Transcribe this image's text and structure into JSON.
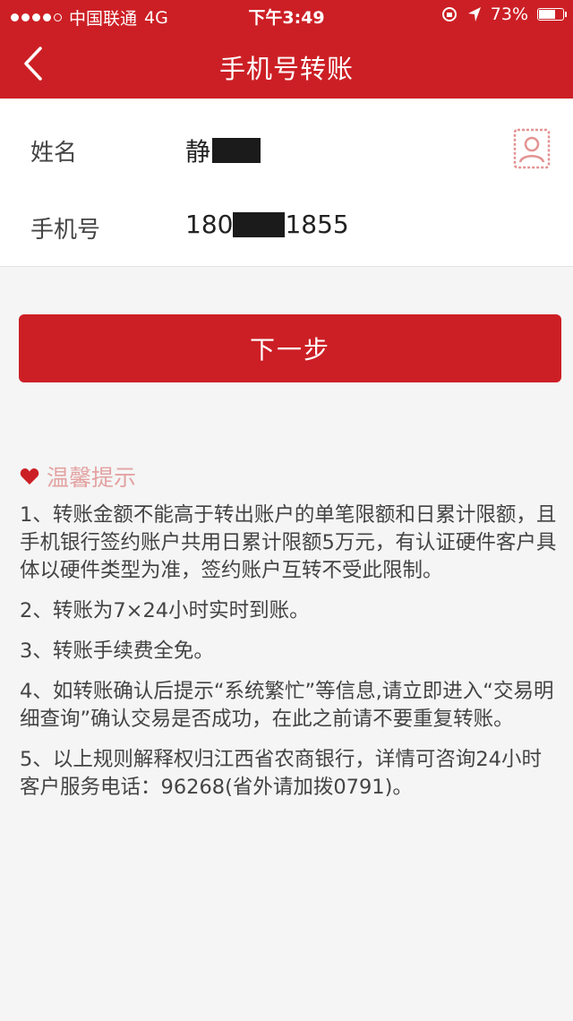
{
  "status_bar": {
    "carrier": "中国联通",
    "network": "4G",
    "time": "下午3:49",
    "battery": "73%",
    "battery_level": 0.73
  },
  "nav": {
    "title": "手机号转账",
    "back_icon": "chevron-left-icon"
  },
  "form": {
    "name_label": "姓名",
    "name_value": "静",
    "phone_label": "手机号",
    "phone_prefix": "180",
    "phone_suffix": "1855",
    "contact_icon": "contact-card-icon"
  },
  "next_button": "下一步",
  "tips": {
    "title": "温馨提示",
    "icon": "heart-icon",
    "items": [
      "1、转账金额不能高于转出账户的单笔限额和日累计限额，且手机银行签约账户共用日累计限额5万元，有认证硬件客户具体以硬件类型为准，签约账户互转不受此限制。",
      "2、转账为7×24小时实时到账。",
      "3、转账手续费全免。",
      "4、如转账确认后提示“系统繁忙”等信息,请立即进入“交易明细查询”确认交易是否成功，在此之前请不要重复转账。",
      "5、以上规则解释权归江西省农商银行，详情可咨询24小时客户服务电话：96268(省外请加拨0791)。"
    ]
  },
  "colors": {
    "brand_red": "#cc1f25",
    "tip_title": "#e3a2a2"
  }
}
